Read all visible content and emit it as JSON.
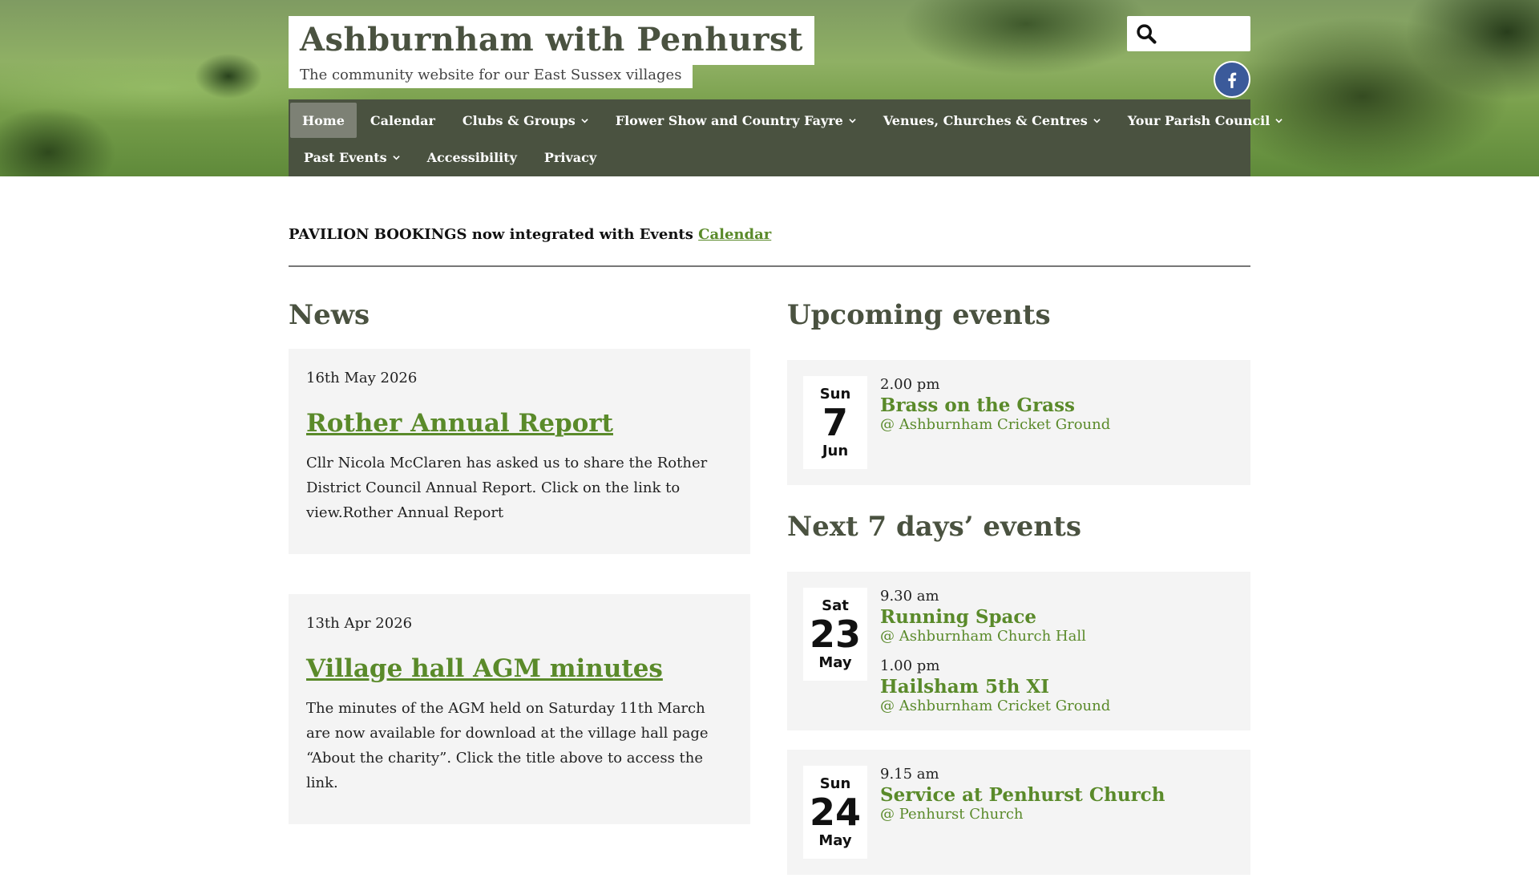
{
  "site": {
    "title": "Ashburnham with Penhurst",
    "tagline": "The community website for our East Sussex villages"
  },
  "search": {
    "placeholder": ""
  },
  "nav": {
    "row1": [
      {
        "label": "Home",
        "active": true,
        "dropdown": false
      },
      {
        "label": "Calendar",
        "dropdown": false
      },
      {
        "label": "Clubs & Groups",
        "dropdown": true
      },
      {
        "label": "Flower Show and Country Fayre",
        "dropdown": true
      },
      {
        "label": "Venues, Churches & Centres",
        "dropdown": true
      },
      {
        "label": "Your Parish Council",
        "dropdown": true
      }
    ],
    "row2": [
      {
        "label": "Past Events",
        "dropdown": true
      },
      {
        "label": "Accessibility",
        "dropdown": false
      },
      {
        "label": "Privacy",
        "dropdown": false
      }
    ]
  },
  "notice": {
    "text": "PAVILION BOOKINGS now integrated with Events ",
    "link": "Calendar"
  },
  "news": {
    "heading": "News",
    "items": [
      {
        "date": "16th May 2026",
        "title": "Rother Annual Report",
        "body": "Cllr Nicola McClaren has asked us to share the Rother District Council Annual Report. Click on the link to view.Rother Annual Report"
      },
      {
        "date": "13th Apr 2026",
        "title": "Village hall AGM minutes",
        "body": "The minutes of the AGM held on Saturday 11th March are now available for download at the village hall page “About the charity”. Click the title above to access the link."
      }
    ]
  },
  "upcoming": {
    "heading": "Upcoming events",
    "days": [
      {
        "day": "Sun",
        "num": "7",
        "month": "Jun",
        "events": [
          {
            "time": "2.00 pm",
            "name": "Brass on the Grass",
            "venue": "@ Ashburnham Cricket Ground"
          }
        ]
      }
    ]
  },
  "next7": {
    "heading": "Next 7 days’ events",
    "days": [
      {
        "day": "Sat",
        "num": "23",
        "month": "May",
        "events": [
          {
            "time": "9.30 am",
            "name": "Running Space",
            "venue": "@ Ashburnham Church Hall"
          },
          {
            "time": "1.00 pm",
            "name": "Hailsham 5th XI",
            "venue": "@ Ashburnham Cricket Ground"
          }
        ]
      },
      {
        "day": "Sun",
        "num": "24",
        "month": "May",
        "events": [
          {
            "time": "9.15 am",
            "name": "Service at Penhurst Church",
            "venue": "@ Penhurst Church"
          }
        ]
      }
    ]
  },
  "colors": {
    "nav_bg": "#4a5240",
    "accent": "#5a8a2a",
    "card_bg": "#f4f4f4",
    "facebook": "#3b5a9a"
  },
  "icons": {
    "search": "search-icon",
    "facebook": "facebook-icon",
    "dropdown": "chevron-down-icon"
  }
}
